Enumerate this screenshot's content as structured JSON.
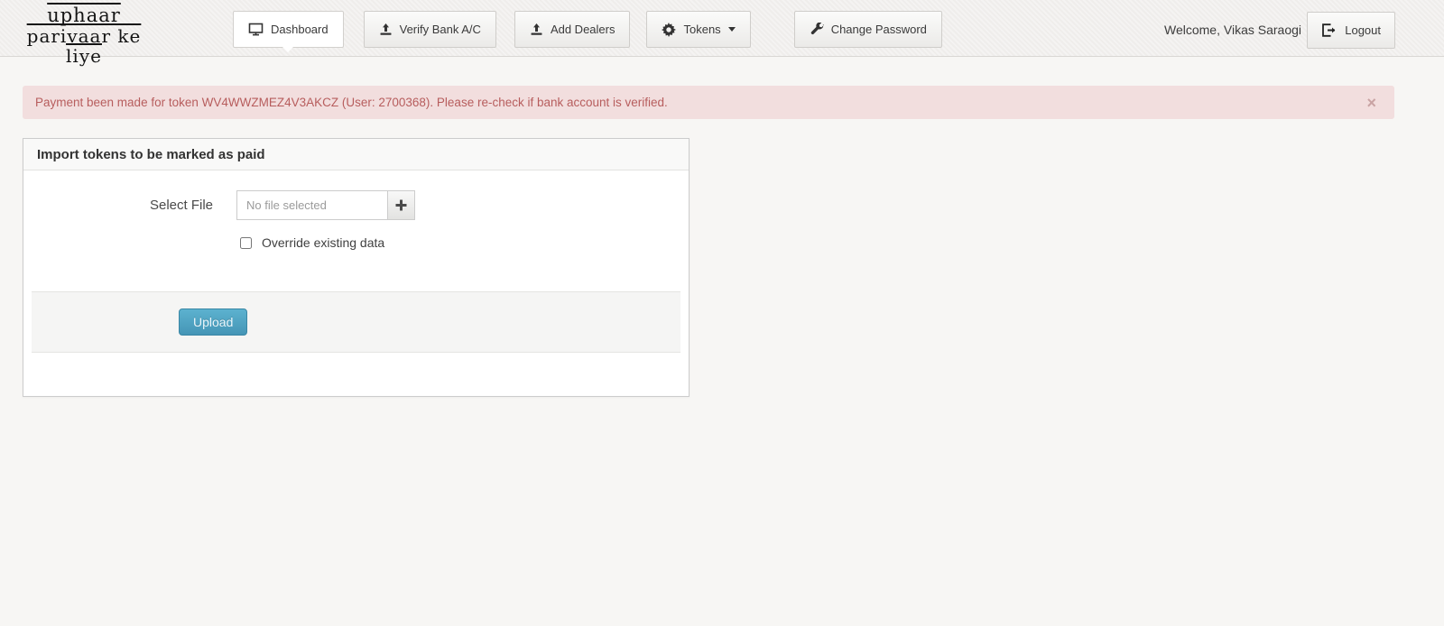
{
  "logo": {
    "line1": "uphaar",
    "line2": "parivaar ke liye"
  },
  "nav": {
    "items": [
      {
        "label": "Dashboard",
        "active": true
      },
      {
        "label": "Verify Bank A/C",
        "active": false
      },
      {
        "label": "Add Dealers",
        "active": false
      },
      {
        "label": "Tokens",
        "active": false
      },
      {
        "label": "Change Password",
        "active": false
      }
    ]
  },
  "header": {
    "welcome_text": "Welcome, Vikas Saraogi",
    "logout_label": "Logout"
  },
  "alert": {
    "message": "Payment been made for token WV4WWZMEZ4V3AKCZ (User: 2700368). Please re-check if bank account is verified.",
    "close_glyph": "×",
    "bg_color": "#f2dede",
    "text_color": "#b75d5d"
  },
  "panel": {
    "title": "Import tokens to be marked as paid",
    "select_file_label": "Select File",
    "file_placeholder": "No file selected",
    "override_label": "Override existing data",
    "override_checked": false,
    "upload_label": "Upload",
    "upload_color": "#4d9fbf"
  }
}
